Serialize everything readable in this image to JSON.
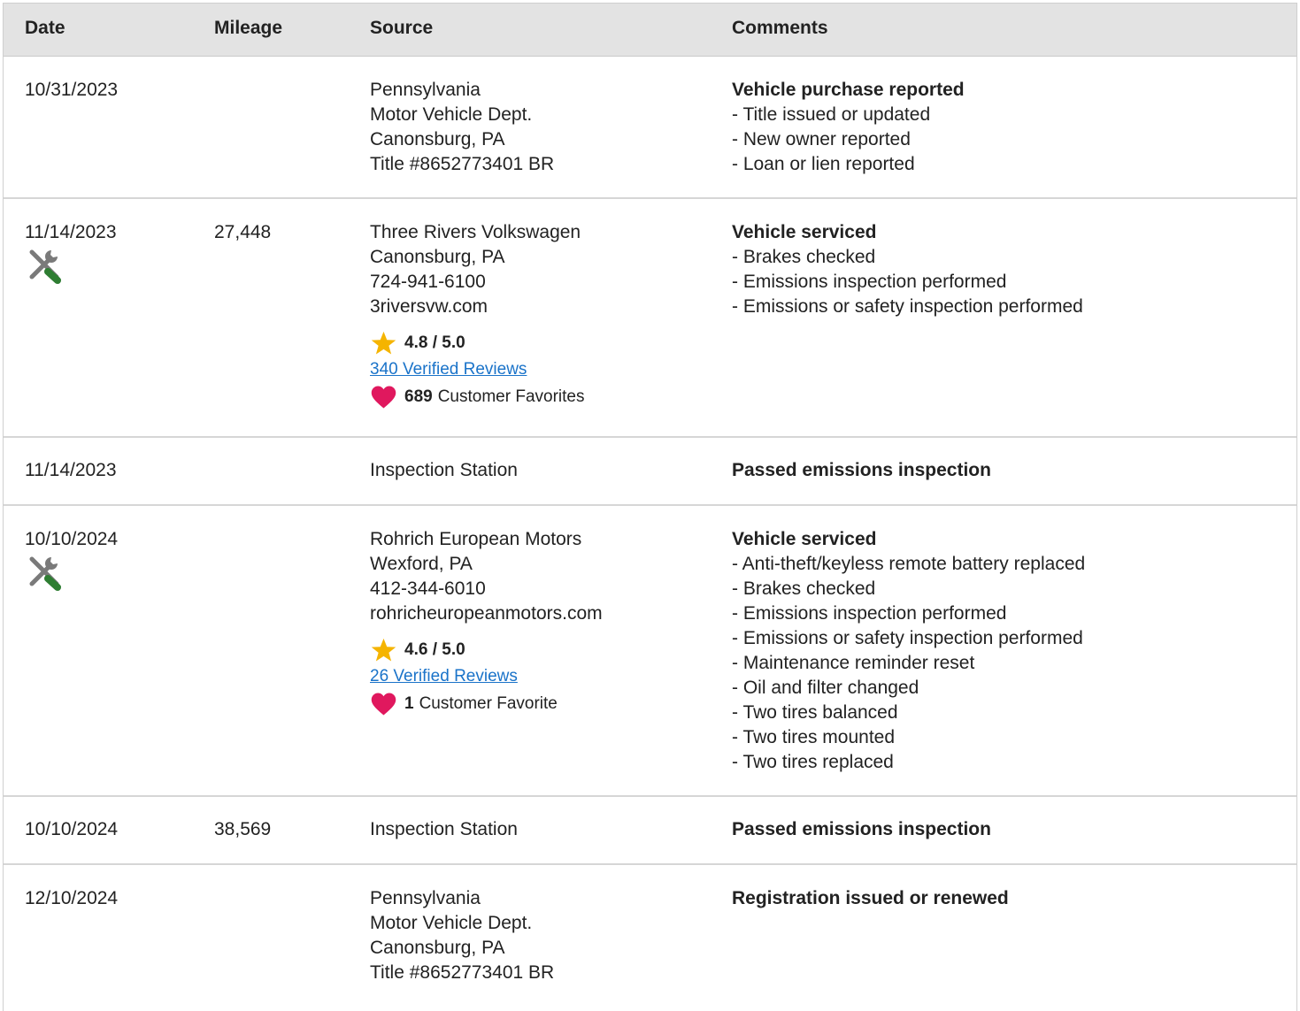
{
  "header": {
    "date": "Date",
    "mileage": "Mileage",
    "source": "Source",
    "comments": "Comments"
  },
  "colors": {
    "header_bg": "#e3e3e3",
    "link": "#1a73c9",
    "star": "#f5b400",
    "heart": "#e0185e",
    "wrench_green": "#2e7d32"
  },
  "records": [
    {
      "date": "10/31/2023",
      "mileage": "",
      "source": [
        "Pennsylvania",
        "Motor Vehicle Dept.",
        "Canonsburg, PA",
        "Title #8652773401 BR"
      ],
      "comment_title": "Vehicle purchase reported",
      "comment_items": [
        "- Title issued or updated",
        "- New owner reported",
        "- Loan or lien reported"
      ]
    },
    {
      "date": "11/14/2023",
      "mileage": "27,448",
      "icon": "service-tools-icon",
      "source": [
        "Three Rivers Volkswagen",
        "Canonsburg, PA",
        "724-941-6100",
        "3riversvw.com"
      ],
      "rating": "4.8 / 5.0",
      "reviews": "340 Verified Reviews",
      "favorites_count": "689",
      "favorites_label": "Customer Favorites",
      "comment_title": "Vehicle serviced",
      "comment_items": [
        "- Brakes checked",
        "- Emissions inspection performed",
        "- Emissions or safety inspection performed"
      ]
    },
    {
      "date": "11/14/2023",
      "mileage": "",
      "source": [
        "Inspection Station"
      ],
      "comment_title": "Passed emissions inspection",
      "comment_items": []
    },
    {
      "date": "10/10/2024",
      "mileage": "",
      "icon": "service-tools-icon",
      "source": [
        "Rohrich European Motors",
        "Wexford, PA",
        "412-344-6010",
        "rohricheuropeanmotors.com"
      ],
      "rating": "4.6 / 5.0",
      "reviews": "26 Verified Reviews",
      "favorites_count": "1",
      "favorites_label": "Customer Favorite",
      "comment_title": "Vehicle serviced",
      "comment_items": [
        "- Anti-theft/keyless remote battery replaced",
        "- Brakes checked",
        "- Emissions inspection performed",
        "- Emissions or safety inspection performed",
        "- Maintenance reminder reset",
        "- Oil and filter changed",
        "- Two tires balanced",
        "- Two tires mounted",
        "- Two tires replaced"
      ]
    },
    {
      "date": "10/10/2024",
      "mileage": "38,569",
      "source": [
        "Inspection Station"
      ],
      "comment_title": "Passed emissions inspection",
      "comment_items": []
    },
    {
      "date": "12/10/2024",
      "mileage": "",
      "source": [
        "Pennsylvania",
        "Motor Vehicle Dept.",
        "Canonsburg, PA",
        "Title #8652773401 BR"
      ],
      "comment_title": "Registration issued or renewed",
      "comment_items": []
    }
  ]
}
